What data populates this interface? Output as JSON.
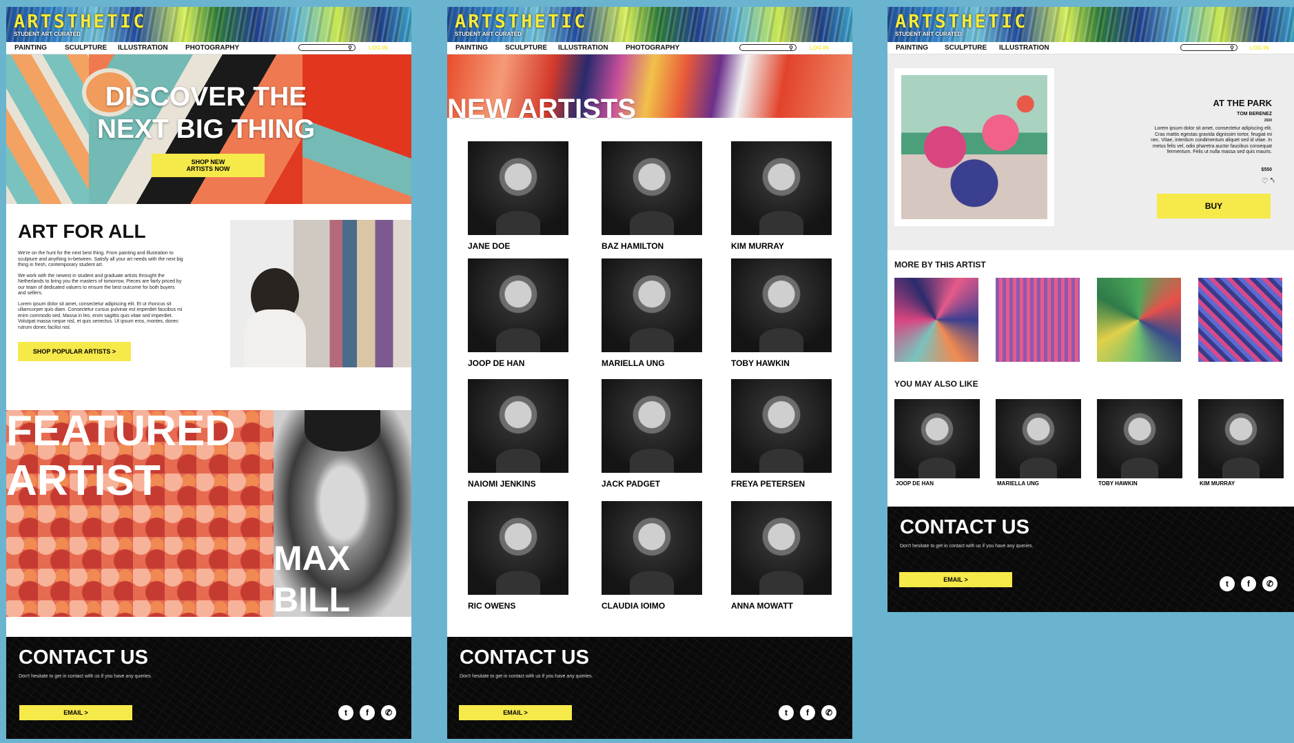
{
  "site": {
    "logo": "ARTSTHETIC",
    "tagline": "STUDENT ART CURATED",
    "login": "LOG IN"
  },
  "nav_main": [
    "PAINTING",
    "SCULPTURE",
    "ILLUSTRATION",
    "PHOTOGRAPHY"
  ],
  "nav_detail": [
    "PAINTING",
    "SCULPTURE",
    "ILLUSTRATION"
  ],
  "home": {
    "hero_line1": "DISCOVER THE",
    "hero_line2": "NEXT BIG THING",
    "hero_cta": "SHOP NEW ARTISTS NOW",
    "section_title": "ART FOR ALL",
    "para1": "We're on the hunt for the next best thing. From painting and illustration to sculpture and anything in-between. Satisfy all your art needs with the next big thing in fresh, contemporary student art.",
    "para2": "We work with the newest in student and graduate artists throught the Netherlands to bring you the masters of tomorrow. Pieces are fairly priced by our team of dedicated valuers to ensure the best outcome for both buyers and sellers.",
    "para3": "Lorem ipsum dolor sit amet, consectetur adipiscing elit. Et ut rhoncus sit ullamcorper quis diam. Consectetur cursus pulvinar est imperdiet faucibus mi enim commodo sed. Massa in leo, enim sagittis quis vitae sed imperdiet. Volutpat massa neque nisl, et quis senectus. Ut ipsum eros, montes, donec rutrum donec facilisi nisl.",
    "popular_cta": "SHOP POPULAR ARTISTS >",
    "featured_line1": "FEATURED",
    "featured_line2": "ARTIST",
    "featured_name1": "MAX",
    "featured_name2": "BILL"
  },
  "artists": {
    "title": "NEW ARTISTS",
    "names": [
      "JANE DOE",
      "BAZ HAMILTON",
      "KIM MURRAY",
      "JOOP DE HAN",
      "MARIELLA UNG",
      "TOBY HAWKIN",
      "NAIOMI JENKINS",
      "JACK PADGET",
      "FREYA PETERSEN",
      "RIC OWENS",
      "CLAUDIA IOIMO",
      "ANNA MOWATT"
    ]
  },
  "detail": {
    "title": "AT THE PARK",
    "artist": "TOM BERENEZ",
    "year": "2020",
    "description": "Lorem ipsum dolor sit amet, consectetur adipiscing elit. Cras mattis egestas gravida dignissim tortor, feugiat mi nec. Vitae, interdum condimentum aliquet sed id vitae. In metus felis vel, odio pharetra auctor faucibus consequat fermentum. Felis ut nulla massa sed quis mauris.",
    "price": "$550",
    "buy": "BUY",
    "more_title": "MORE BY THIS ARTIST",
    "also_title": "YOU MAY ALSO LIKE",
    "also_names": [
      "JOOP DE HAN",
      "MARIELLA UNG",
      "TOBY HAWKIN",
      "KIM MURRAY"
    ]
  },
  "contact": {
    "title": "CONTACT US",
    "subtitle": "Don't hesitate to get in contact with us if you have any queries.",
    "email": "EMAIL >"
  },
  "icons": [
    "search-icon",
    "twitter-icon",
    "facebook-icon",
    "whatsapp-icon",
    "heart-icon",
    "share-icon"
  ],
  "colors": {
    "accent": "#f6e94a",
    "background": "#6ab4cf",
    "footer": "#0a0a0a"
  }
}
